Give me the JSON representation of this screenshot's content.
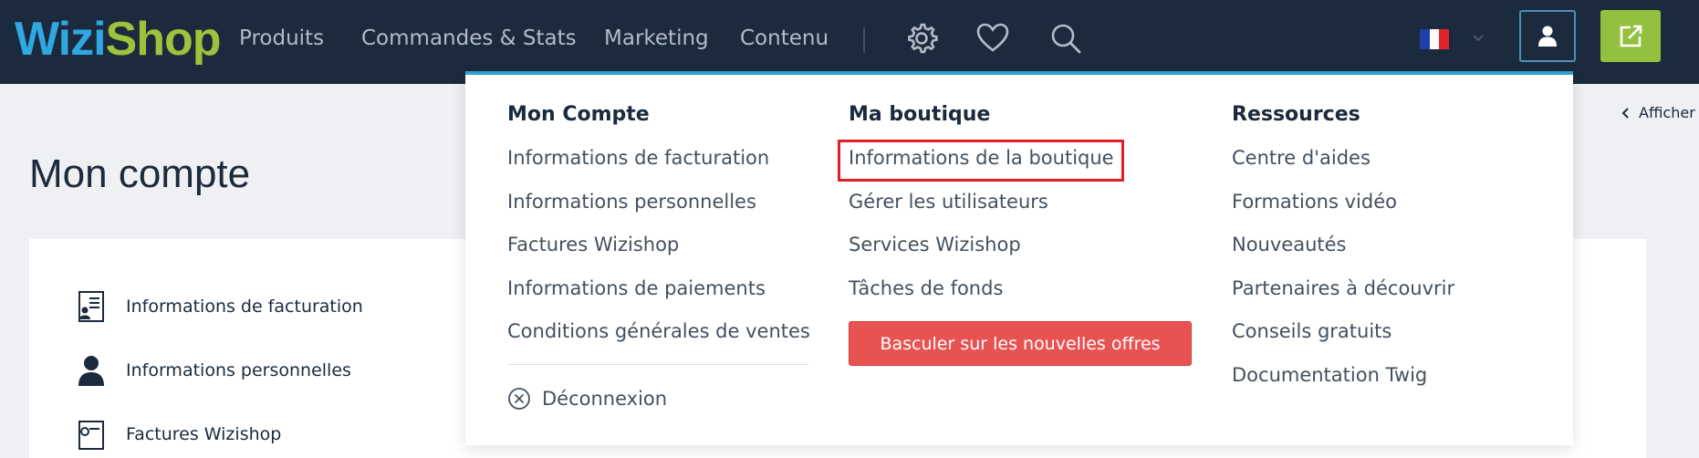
{
  "brand": {
    "logo_part1": "Wizi",
    "logo_part2": "Shop"
  },
  "nav": {
    "items": [
      "Produits",
      "Commandes & Stats",
      "Marketing",
      "Contenu"
    ]
  },
  "icons": {
    "settings": "gear-icon",
    "favorites": "heart-icon",
    "search": "search-icon",
    "language": "france-flag-icon",
    "account": "user-icon",
    "external": "external-link-icon"
  },
  "colors": {
    "topbar": "#1b2a3c",
    "logo_blue": "#2fa7e0",
    "logo_green": "#9dc23b",
    "accent_blue": "#2fa0cf",
    "accent_green": "#93c13e",
    "cta_red": "#e85352",
    "highlight_red": "#e01e26"
  },
  "page": {
    "title": "Mon compte",
    "afficher_label": "Afficher",
    "card_items": [
      "Informations de facturation",
      "Informations personnelles",
      "Factures Wizishop"
    ]
  },
  "menu": {
    "col1": {
      "title": "Mon Compte",
      "links": [
        "Informations de facturation",
        "Informations personnelles",
        "Factures Wizishop",
        "Informations de paiements",
        "Conditions générales de ventes"
      ],
      "logout_label": "Déconnexion"
    },
    "col2": {
      "title": "Ma boutique",
      "links": [
        "Informations de la boutique",
        "Gérer les utilisateurs",
        "Services Wizishop",
        "Tâches de fonds"
      ],
      "cta_label": "Basculer sur les nouvelles offres"
    },
    "col3": {
      "title": "Ressources",
      "links": [
        "Centre d'aides",
        "Formations vidéo",
        "Nouveautés",
        "Partenaires à découvrir",
        "Conseils gratuits",
        "Documentation Twig"
      ]
    }
  }
}
